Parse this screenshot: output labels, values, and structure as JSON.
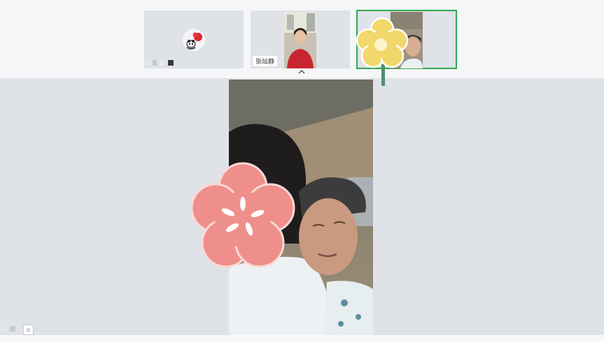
{
  "participants": [
    {
      "id": "p1",
      "name": "",
      "name_hidden": true,
      "avatar": "panda-avatar-icon",
      "active": false
    },
    {
      "id": "p2",
      "name": "张灿静",
      "avatar": "video",
      "active": false
    },
    {
      "id": "p3",
      "name": "",
      "avatar": "video",
      "active": true
    }
  ],
  "controls": {
    "collapse_icon": "chevron-up-icon",
    "corner_icon": "lock-icon",
    "corner_glyph": "⌂"
  },
  "stickers": [
    "yellow-flower-icon",
    "pink-flower-icon"
  ],
  "colors": {
    "active_border": "#2fa84f",
    "stage_bg": "#dfe2e6",
    "pink_flower": "#ef8f8c",
    "yellow_flower": "#f2d86a"
  }
}
